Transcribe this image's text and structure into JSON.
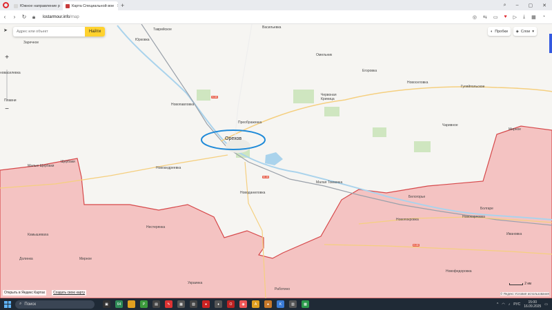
{
  "browser": {
    "tabs": [
      {
        "title": "Южное направление р",
        "active": false,
        "favicon_color": "#d8d8d8"
      },
      {
        "title": "Карта Специальной вое",
        "active": true,
        "favicon_color": "#c73b3b"
      }
    ],
    "url_host": "lostarmour.info",
    "url_path": "/map"
  },
  "map": {
    "search_placeholder": "Адрес или объект",
    "search_button": "Найти",
    "traffic_label": "Пробки",
    "layers_label": "Слои",
    "zoom_in": "+",
    "zoom_out": "−",
    "highlighted_city": "Орехов",
    "places": {
      "tavriyskoe": "Таврийское",
      "yurkovka": "Юрковка",
      "vasilevka": "Васильевка",
      "zarechnoe": "Заречное",
      "novovasilevka": "новасилевка",
      "plavni": "Плавни",
      "omelnik": "Омельник",
      "egorovka": "Егоровка",
      "novoselovka": "Новоселовка",
      "gulyaypolskoe": "Гуляйпольское",
      "novopavlovka": "Новопавловка",
      "chervonaya_krinitsa": "Червоная\nКриница",
      "preobrazhenka": "Преображенка",
      "charivnoe": "Чаривное",
      "mirnoe_east": "Мирное",
      "malye_shcherbaki": "Малые Щербаки",
      "shcherbaki": "Щербаки",
      "novoandreevka": "Новоандреевка",
      "malaya_tokmachka": "Малая Токмачка",
      "belogorye": "Белогорье",
      "novodanilovka": "Новоданиловка",
      "bolgare": "Болгаре",
      "novopokrovka": "Новопокровка",
      "novokarlovka": "Новокарловка",
      "ivanovka": "Ивановка",
      "kamyshevakha": "Камышеваха",
      "nesterianka": "Нестерянка",
      "dolinka": "Долинка",
      "mirnoe_west": "Мирное",
      "novofedorovka": "Новофедоровка",
      "rabotino": "Работино",
      "ukrainka": "Украинка"
    },
    "road_badges": [
      "Н-08",
      "М-18",
      "Н-08"
    ],
    "open_in_yandex": "Открыть в Яндекс Картах",
    "create_map": "Создать свою карту",
    "scale": "2 км",
    "copyright": "© Яндекс Условия использования",
    "colors": {
      "occupied_zone": "#f4c3c2",
      "front_line": "#d6484a",
      "highlight_ellipse": "#1f8ad8",
      "water": "#aad3ec",
      "forest": "#cfe6c0"
    }
  },
  "taskbar": {
    "search_label": "Поиск",
    "language": "РУС",
    "time": "15:00",
    "date": "16.09.2025"
  }
}
